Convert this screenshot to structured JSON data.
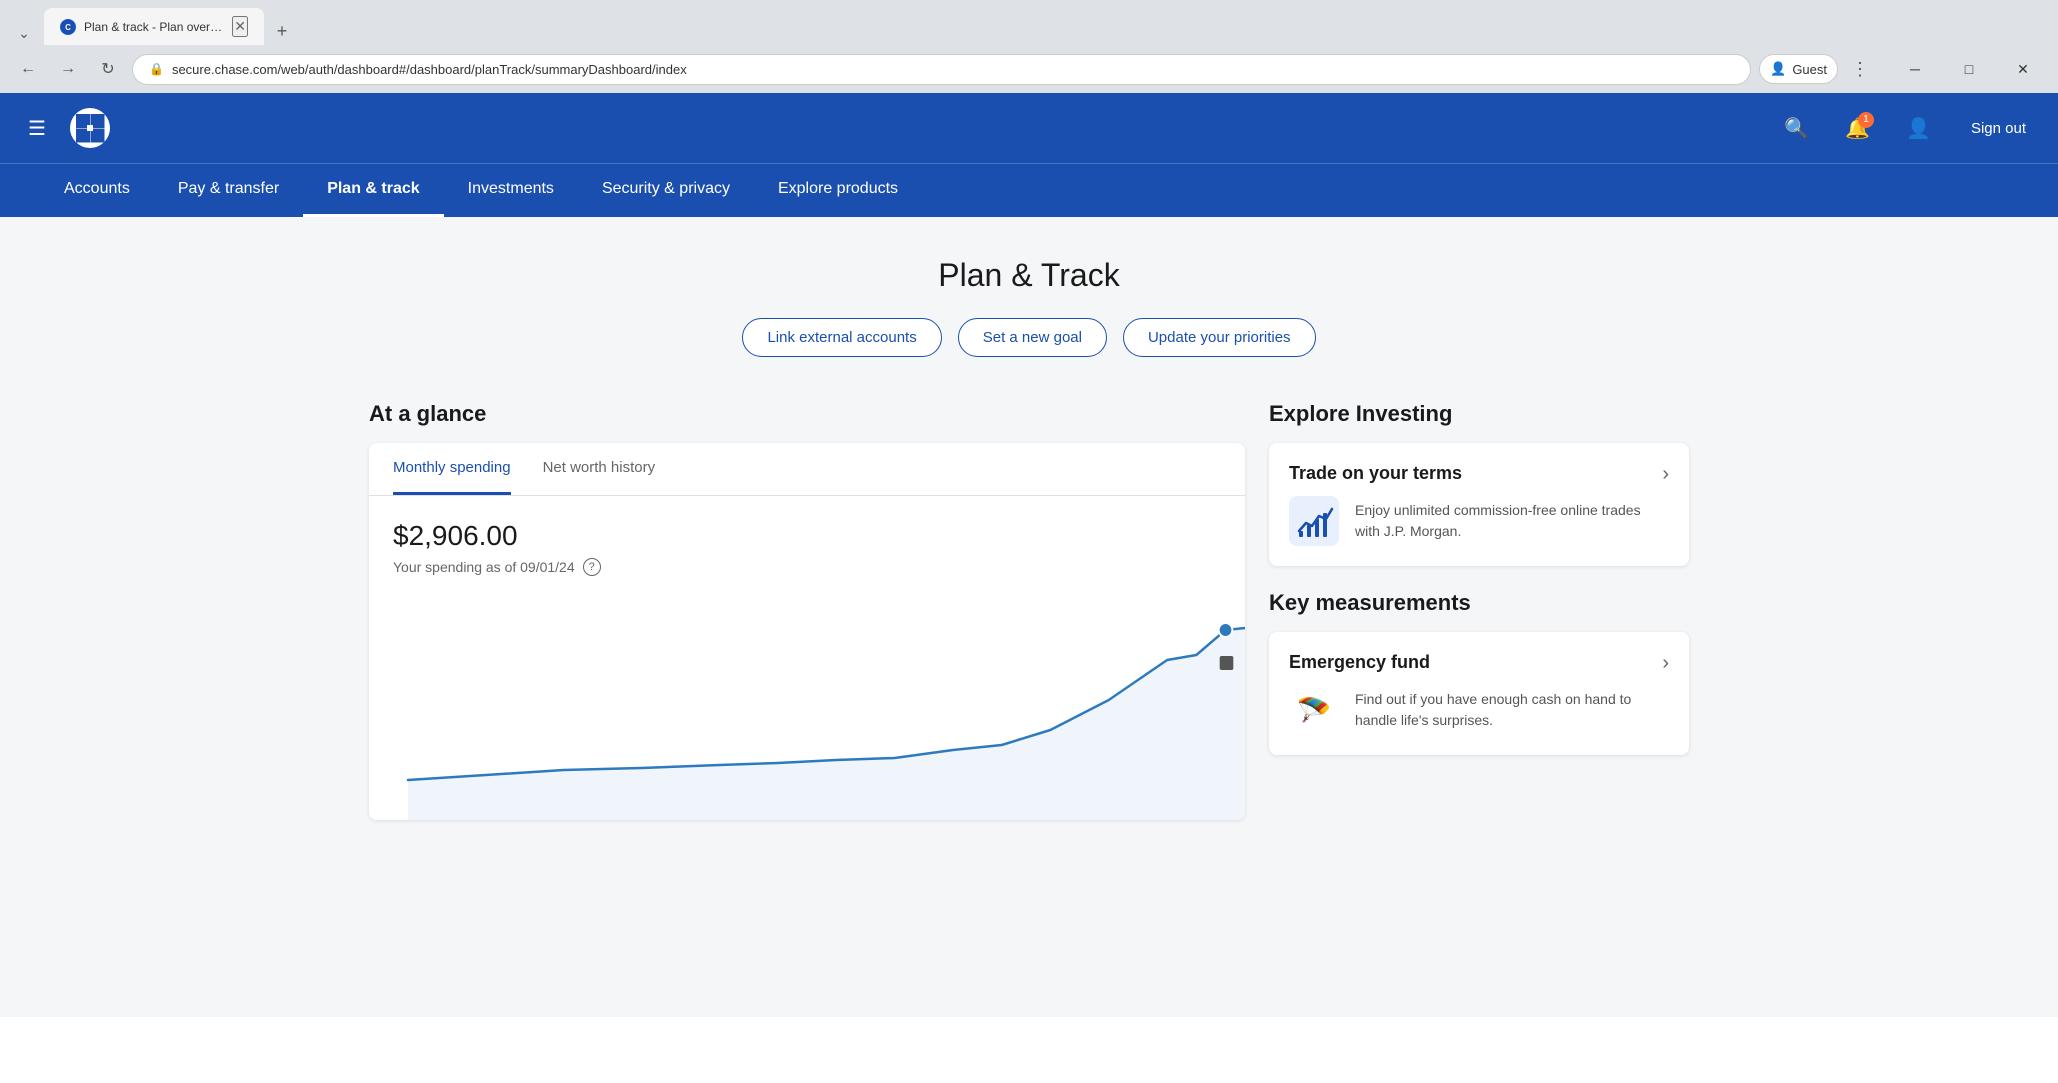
{
  "browser": {
    "url": "secure.chase.com/web/auth/dashboard#/dashboard/planTrack/summaryDashboard/index",
    "tab_title": "Plan & track - Plan overview - c",
    "tab_favicon": "C",
    "new_tab_label": "+",
    "back_btn": "←",
    "forward_btn": "→",
    "refresh_btn": "↻",
    "guest_label": "Guest",
    "window_controls": {
      "minimize": "─",
      "maximize": "□",
      "close": "✕"
    }
  },
  "topnav": {
    "hamburger": "☰",
    "logo_alt": "Chase",
    "notification_count": "1",
    "sign_out": "Sign out"
  },
  "mainnav": {
    "items": [
      {
        "id": "accounts",
        "label": "Accounts",
        "active": false
      },
      {
        "id": "pay-transfer",
        "label": "Pay & transfer",
        "active": false
      },
      {
        "id": "plan-track",
        "label": "Plan & track",
        "active": true
      },
      {
        "id": "investments",
        "label": "Investments",
        "active": false
      },
      {
        "id": "security-privacy",
        "label": "Security & privacy",
        "active": false
      },
      {
        "id": "explore-products",
        "label": "Explore products",
        "active": false
      }
    ]
  },
  "page": {
    "title": "Plan & Track",
    "actions": {
      "link_accounts": "Link external accounts",
      "set_goal": "Set a new goal",
      "update_priorities": "Update your priorities"
    }
  },
  "at_a_glance": {
    "section_title": "At a glance",
    "tabs": [
      {
        "id": "monthly-spending",
        "label": "Monthly spending",
        "active": true
      },
      {
        "id": "net-worth-history",
        "label": "Net worth history",
        "active": false
      }
    ],
    "spending_amount": "$2,906.00",
    "spending_date_text": "Your spending as of 09/01/24",
    "help_icon_label": "?"
  },
  "explore_investing": {
    "section_title": "Explore Investing",
    "card": {
      "title": "Trade on your terms",
      "description": "Enjoy unlimited commission-free online trades with J.P. Morgan.",
      "icon_emoji": "📈"
    }
  },
  "key_measurements": {
    "section_title": "Key measurements",
    "card": {
      "title": "Emergency fund",
      "description": "Find out if you have enough cash on hand to handle life's surprises.",
      "icon_emoji": "🪂"
    }
  }
}
